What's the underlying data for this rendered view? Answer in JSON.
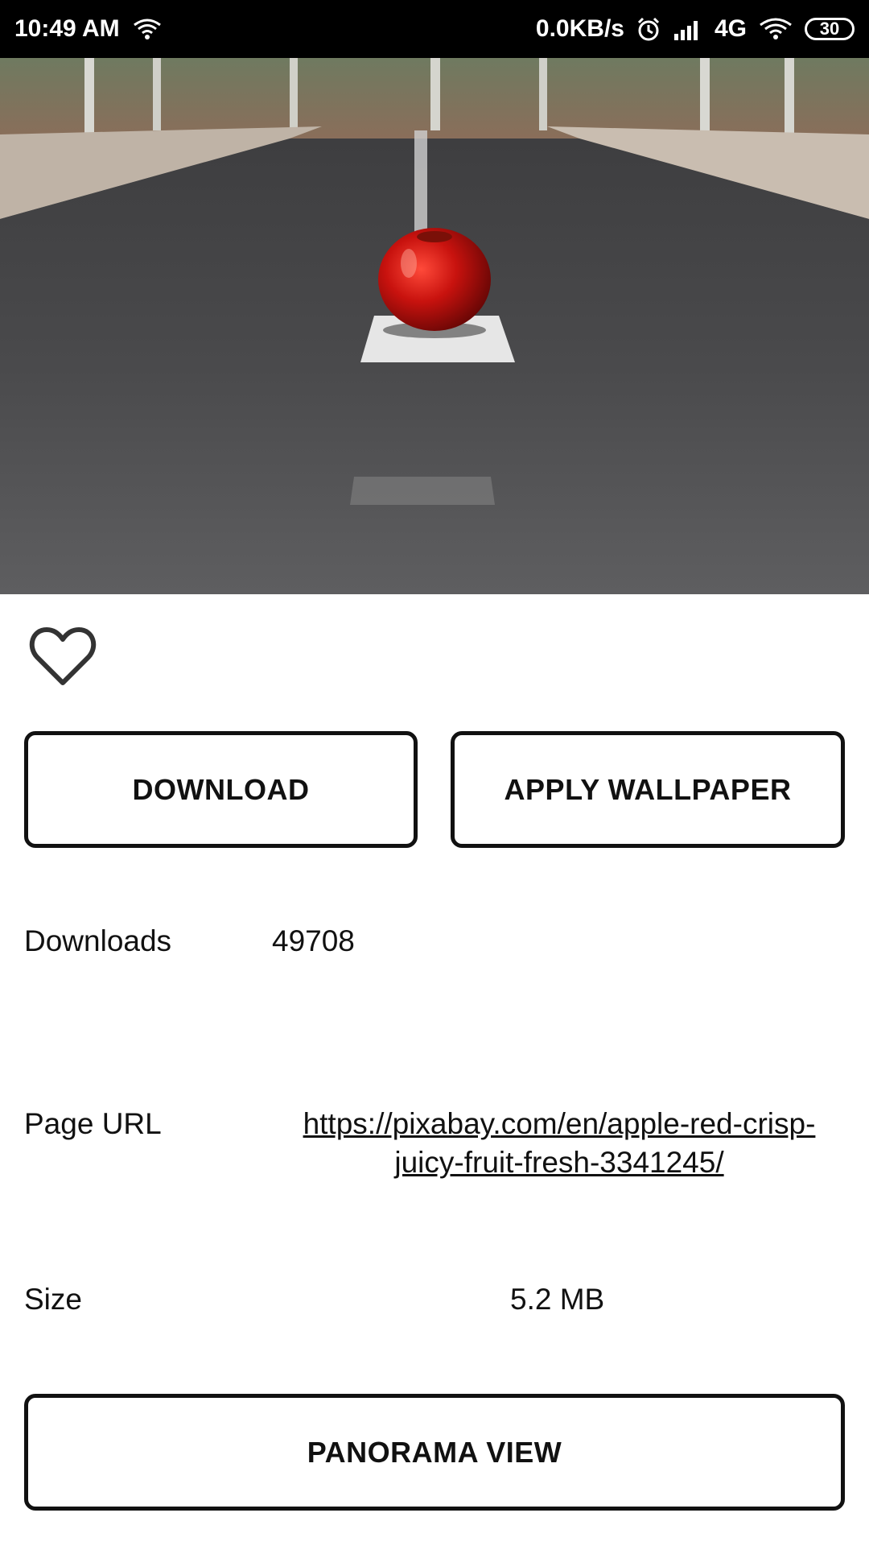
{
  "status_bar": {
    "time": "10:49 AM",
    "speed": "0.0KB/s",
    "network": "4G",
    "battery": "30"
  },
  "hero": {
    "alt": "red apple on road"
  },
  "actions": {
    "download_label": "DOWNLOAD",
    "apply_label": "APPLY WALLPAPER",
    "panorama_label": "PANORAMA VIEW"
  },
  "details": {
    "downloads_label": "Downloads",
    "downloads_value": "49708",
    "page_url_label": "Page URL",
    "page_url_value": "https://pixabay.com/en/apple-red-crisp-juicy-fruit-fresh-3341245/",
    "size_label": "Size",
    "size_value": "5.2 MB"
  },
  "icons": {
    "favorite": "heart-outline-icon"
  }
}
